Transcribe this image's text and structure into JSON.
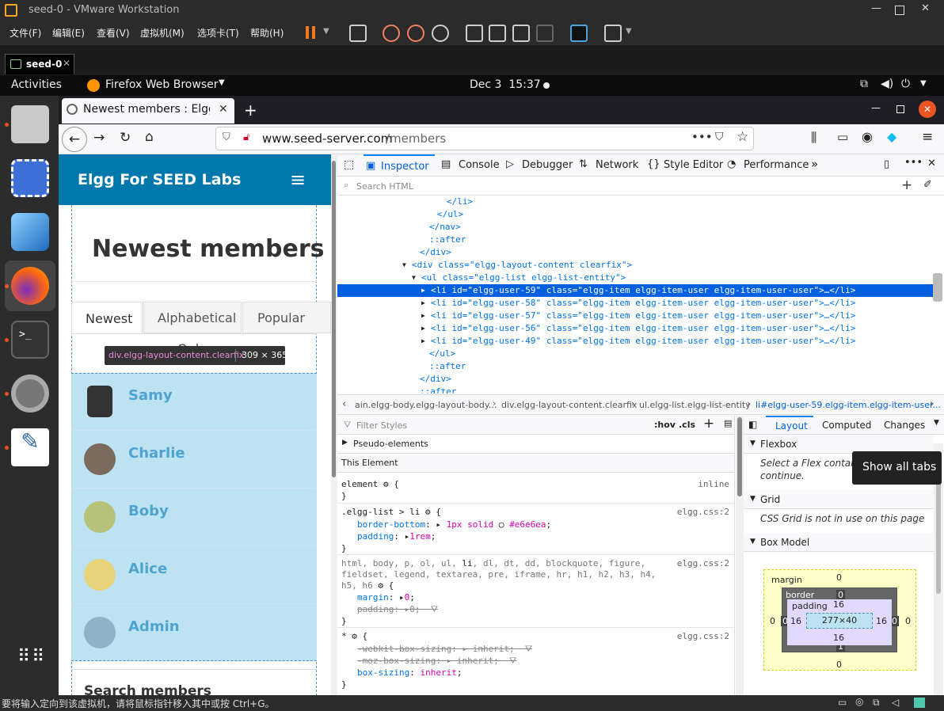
{
  "vmware": {
    "title": "seed-0 - VMware Workstation",
    "menu": [
      "文件(F)",
      "编辑(E)",
      "查看(V)",
      "虚拟机(M)",
      "选项卡(T)",
      "帮助(H)"
    ],
    "tab": "seed-0",
    "status": "要将输入定向到该虚拟机，请将鼠标指针移入其中或按 Ctrl+G。"
  },
  "gnome": {
    "activities": "Activities",
    "app": "Firefox Web Browser",
    "clock": "Dec 3  15:37"
  },
  "firefox": {
    "tab_title": "Newest members : Elgg f",
    "url_domain": "www.seed-server.com",
    "url_path": "/members"
  },
  "page": {
    "site_title": "Elgg For SEED Labs",
    "heading": "Newest members",
    "tabs": [
      "Newest",
      "Alphabetical",
      "Popular"
    ],
    "tooltip_selector": "div.elgg-layout-content.clearfix",
    "tooltip_size": "309 × 365",
    "tooltip_under": "Onl...",
    "members": [
      "Samy",
      "Charlie",
      "Boby",
      "Alice",
      "Admin"
    ],
    "search_heading": "Search members"
  },
  "devtools": {
    "tabs": [
      "Inspector",
      "Console",
      "Debugger",
      "Network",
      "Style Editor",
      "Performance"
    ],
    "search_placeholder": "Search HTML",
    "markup": [
      {
        "indent": 138,
        "html": "</li>"
      },
      {
        "indent": 126,
        "html": "</ul>"
      },
      {
        "indent": 116,
        "html": "</nav>"
      },
      {
        "indent": 116,
        "html": "::after"
      },
      {
        "indent": 104,
        "html": "</div>"
      },
      {
        "indent": 94,
        "html": "<div class=\"elgg-layout-content clearfix\">"
      },
      {
        "indent": 106,
        "html": "<ul class=\"elgg-list elgg-list-entity\">"
      },
      {
        "indent": 118,
        "html": "<li id=\"elgg-user-59\" class=\"elgg-item elgg-item-user elgg-item-user-user\">…</li>",
        "selected": true
      },
      {
        "indent": 118,
        "html": "<li id=\"elgg-user-58\" class=\"elgg-item elgg-item-user elgg-item-user-user\">…</li>"
      },
      {
        "indent": 118,
        "html": "<li id=\"elgg-user-57\" class=\"elgg-item elgg-item-user elgg-item-user-user\">…</li>"
      },
      {
        "indent": 118,
        "html": "<li id=\"elgg-user-56\" class=\"elgg-item elgg-item-user elgg-item-user-user\">…</li>"
      },
      {
        "indent": 118,
        "html": "<li id=\"elgg-user-49\" class=\"elgg-item elgg-item-user elgg-item-user-user\">…</li>"
      },
      {
        "indent": 116,
        "html": "</ul>"
      },
      {
        "indent": 116,
        "html": "::after"
      },
      {
        "indent": 104,
        "html": "</div>"
      },
      {
        "indent": 104,
        "html": "::after"
      }
    ],
    "breadcrumbs": [
      "ain.elgg-body.elgg-layout-body...",
      "div.elgg-layout-content.clearfix",
      "ul.elgg-list.elgg-list-entity",
      "li#elgg-user-59.elgg-item.elgg-item-user..."
    ],
    "filter_placeholder": "Filter Styles",
    "hov": ":hov",
    "cls": ".cls",
    "pseudo": "Pseudo-elements",
    "this_element": "This Element",
    "layout_tabs": [
      "Layout",
      "Computed",
      "Changes"
    ],
    "tooltip": "Show all tabs",
    "flexbox": "Flexbox",
    "flexbox_msg": "Select a Flex container or item to continue.",
    "grid": "Grid",
    "grid_msg": "CSS Grid is not in use on this page",
    "boxmodel": "Box Model",
    "box": {
      "margin": "margin",
      "border": "border",
      "padding": "padding",
      "content": "277×40",
      "m_top": "0",
      "m_bottom": "0",
      "m_left": "0",
      "m_right": "0",
      "b_top": "0",
      "b_bottom": "1",
      "b_left": "0",
      "b_right": "0",
      "p_top": "16",
      "p_bottom": "16",
      "p_left": "16",
      "p_right": "16"
    }
  }
}
